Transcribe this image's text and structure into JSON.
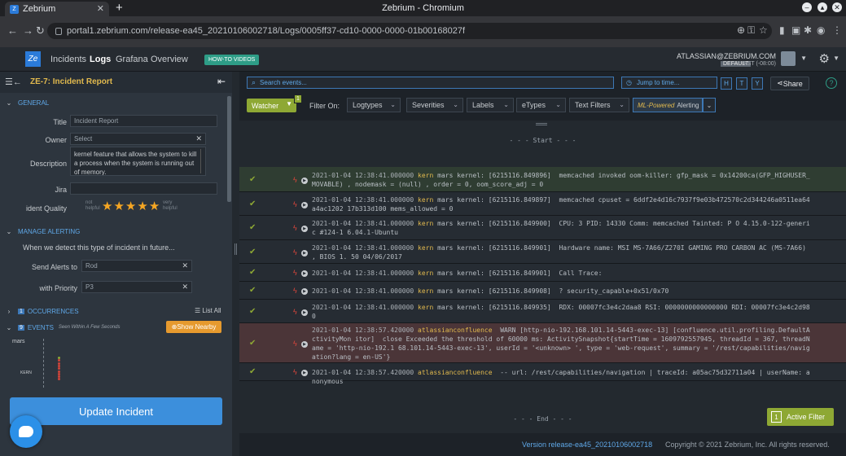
{
  "browser": {
    "tab_title": "Zebrium",
    "window_title": "Zebrium - Chromium",
    "url": "portal1.zebrium.com/release-ea45_20210106002718/Logs/0005ff37-cd10-0000-0000-01b00168027f"
  },
  "header": {
    "logo": "Ze",
    "nav": [
      "Incidents",
      "Logs",
      "Grafana",
      "Overview"
    ],
    "active_nav": "Logs",
    "howto_label": "HOW-TO VIDEOS",
    "user_email": "ATLASSIAN@ZEBRIUM.COM",
    "user_badge": "DEFAULT",
    "user_tz": "PST (-08:00)"
  },
  "incident": {
    "title": "ZE-7: Incident Report",
    "general_label": "GENERAL",
    "fields": {
      "title_label": "Title",
      "title_value": "Incident Report",
      "owner_label": "Owner",
      "owner_value": "Select",
      "description_label": "Description",
      "description_value": "kernel feature that allows the system to kill a process when the system is running out of memory.",
      "jira_label": "Jira",
      "jira_value": "",
      "quality_label": "ident Quality",
      "quality_low": "not helpful",
      "quality_high": "very helpful",
      "quality_rating": 5
    },
    "manage_label": "MANAGE ALERTING",
    "manage_text": "When we detect this type of incident in future...",
    "send_alerts_label": "Send Alerts to",
    "send_alerts_value": "Rod",
    "priority_label": "with Priority",
    "priority_value": "P3",
    "occurrences_label": "OCCURRENCES",
    "occurrences_count": "1",
    "list_all": "List All",
    "events_label": "EVENTS",
    "events_count": "9",
    "events_sub": "Seen Within A Few Seconds",
    "show_nearby": "Show Nearby",
    "chart_host": "mars",
    "chart_kern": "KERN",
    "update_button": "Update Incident"
  },
  "toolbar": {
    "search_placeholder": "Search events...",
    "jump_placeholder": "Jump to time...",
    "hty": [
      "H",
      "T",
      "Y"
    ],
    "share": "Share",
    "watcher": "Watcher",
    "watcher_count": "1",
    "filter_on": "Filter On:",
    "filters": [
      "Logtypes",
      "Severities",
      "Labels",
      "eTypes",
      "Text Filters"
    ],
    "ml_prefix": "ML-Powered",
    "ml_label": "Alerting"
  },
  "logs": {
    "start": "- - -  Start  - - -",
    "end": "- - -  End  - - -",
    "rows": [
      {
        "ts": "2021-01-04 12:38:41.000000",
        "host": "kern",
        "body": "mars kernel: [6215116.849896]  memcached invoked oom-killer: gfp_mask = 0x14200ca(GFP_HIGHUSER_MOVABLE) , nodemask = (null) , order = 0, oom_score_adj = 0",
        "style": "green"
      },
      {
        "ts": "2021-01-04 12:38:41.000000",
        "host": "kern",
        "body": "mars kernel: [6215116.849897]  memcached cpuset = 6ddf2e4d16c7937f9e03b472570c2d344246a0511ea64a4ac1202 17b313d100 mems_allowed = 0",
        "style": "normal"
      },
      {
        "ts": "2021-01-04 12:38:41.000000",
        "host": "kern",
        "body": "mars kernel: [6215116.849900]  CPU: 3 PID: 14330 Comm: memcached Tainted: P O 4.15.0-122-generic #124-1 6.04.1-Ubuntu",
        "style": "normal"
      },
      {
        "ts": "2021-01-04 12:38:41.000000",
        "host": "kern",
        "body": "mars kernel: [6215116.849901]  Hardware name: MSI MS-7A66/Z270I GAMING PRO CARBON AC (MS-7A66) , BIOS 1. 50 04/06/2017",
        "style": "normal"
      },
      {
        "ts": "2021-01-04 12:38:41.000000",
        "host": "kern",
        "body": "mars kernel: [6215116.849901]  Call Trace:",
        "style": "normal"
      },
      {
        "ts": "2021-01-04 12:38:41.000000",
        "host": "kern",
        "body": "mars kernel: [6215116.849908]  ? security_capable+0x51/0x70",
        "style": "normal"
      },
      {
        "ts": "2021-01-04 12:38:41.000000",
        "host": "kern",
        "body": "mars kernel: [6215116.849935]  RDX: 00007fc3e4c2daa8 RSI: 0000000000000000 RDI: 00007fc3e4c2d980",
        "style": "normal"
      },
      {
        "ts": "2021-01-04 12:38:57.420000",
        "host": "atlassianconfluence",
        "body": " WARN [http-nio-192.168.101.14-5443-exec-13] [confluence.util.profiling.DefaultActivityMon itor]  close Exceeded the threshold of 60000 ms: ActivitySnapshot{startTime = 1609792557945, threadId = 367, threadName = 'http-nio-192.1 68.101.14-5443-exec-13', userId = '<unknown> ', type = 'web-request', summary = '/rest/capabilities/navigation?lang = en-US'}",
        "style": "red"
      },
      {
        "ts": "2021-01-04 12:38:57.420000",
        "host": "atlassianconfluence",
        "body": " -- url: /rest/capabilities/navigation | traceId: a05ac75d32711a04 | userName: anonymous",
        "style": "normal"
      }
    ]
  },
  "active_filter": {
    "count": "1",
    "label": "Active Filter"
  },
  "footer": {
    "version": "Version release-ea45_20210106002718",
    "copyright": "Copyright © 2021 Zebrium, Inc. All rights reserved."
  },
  "colors": {
    "accent": "#3c8fdc",
    "watcher": "#8ea834",
    "warn_row": "#4b3538",
    "title": "#e1b94e"
  }
}
